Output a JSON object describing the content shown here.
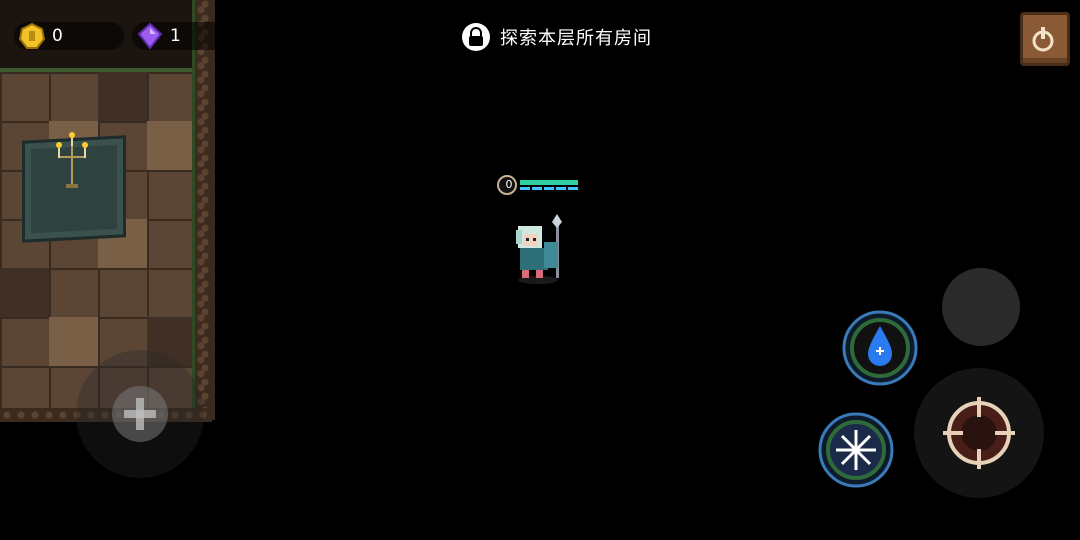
{
  "hud": {
    "coins": "0",
    "gems": "1",
    "objective": "探索本层所有房间",
    "icons": {
      "coin": "gold-coin-icon",
      "gem": "purple-gem-icon",
      "objective": "lock-icon",
      "pause": "pause-book-icon"
    }
  },
  "player": {
    "shield": "0",
    "hp_color": "#2fd0a0",
    "energy_color": "#3fc6ff"
  },
  "controls": {
    "skill_1": "water-drop-skill",
    "skill_2": "snowflake-skill",
    "attack": "crosshair-attack",
    "weapon_swap": "weapon-swap"
  },
  "colors": {
    "background": "#000000",
    "floor": "#5b4636",
    "moss": "#3d5a2e"
  }
}
